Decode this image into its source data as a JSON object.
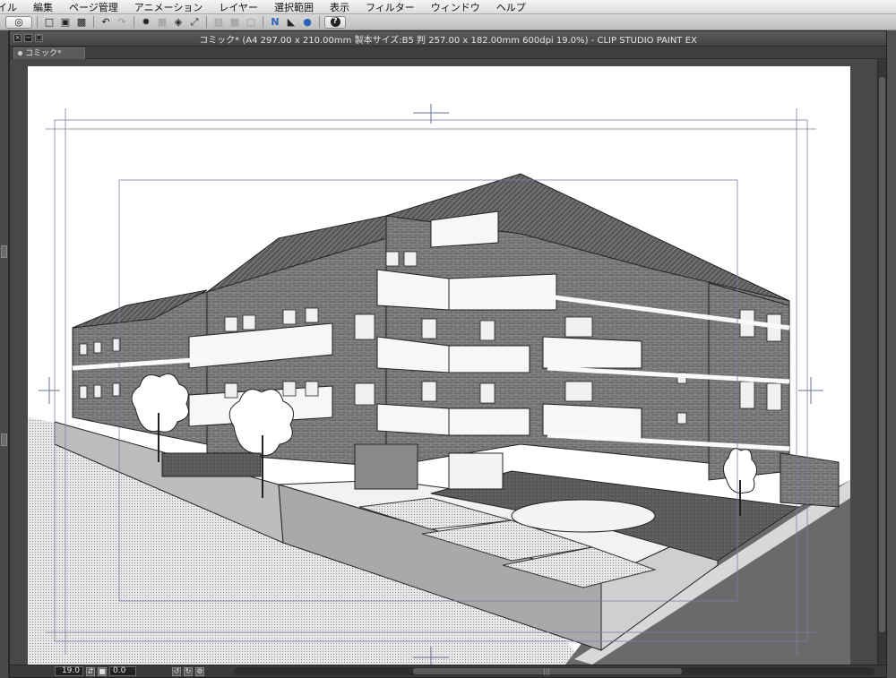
{
  "menu": {
    "items": [
      "イル",
      "編集",
      "ページ管理",
      "アニメーション",
      "レイヤー",
      "選択範囲",
      "表示",
      "フィルター",
      "ウィンドウ",
      "ヘルプ"
    ]
  },
  "window": {
    "title": "コミック* (A4 297.00 x 210.00mm 製本サイズ:B5 判 257.00 x 182.00mm 600dpi 19.0%)  - CLIP STUDIO PAINT EX",
    "tab_label": "コミック*"
  },
  "status": {
    "zoom": "19.0",
    "angle": "0.0"
  },
  "icons": {
    "toolbar": [
      "app-logo-icon",
      "new-file-icon",
      "open-file-icon",
      "save-icon",
      "undo-icon",
      "redo-icon",
      "clear-icon",
      "fill-icon",
      "transform-icon",
      "crop-icon",
      "ruler-icon",
      "snap-ruler-icon",
      "snap-special-icon",
      "help-icon"
    ]
  },
  "colors": {
    "menubar": "#e6e6e6",
    "toolbar": "#c8c8c8",
    "panel_dark": "#484848",
    "canvas_paper": "#ffffff",
    "guide_lines": "#7a7fa3"
  }
}
